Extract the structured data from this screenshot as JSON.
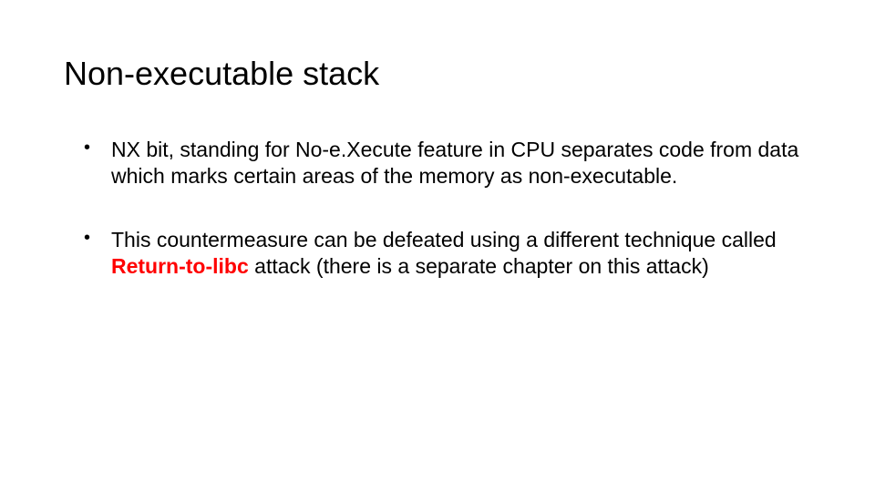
{
  "title": "Non-executable stack",
  "bullets": [
    {
      "segments": [
        {
          "text": "NX bit, standing for No-e.Xecute feature in CPU separates code from data which marks certain areas of the memory as non-executable.",
          "cls": ""
        }
      ]
    },
    {
      "segments": [
        {
          "text": "This countermeasure can be defeated using a different technique called ",
          "cls": ""
        },
        {
          "text": "Return-to-libc",
          "cls": "red-bold"
        },
        {
          "text": " attack (there is a separate chapter on this attack)",
          "cls": ""
        }
      ]
    }
  ]
}
